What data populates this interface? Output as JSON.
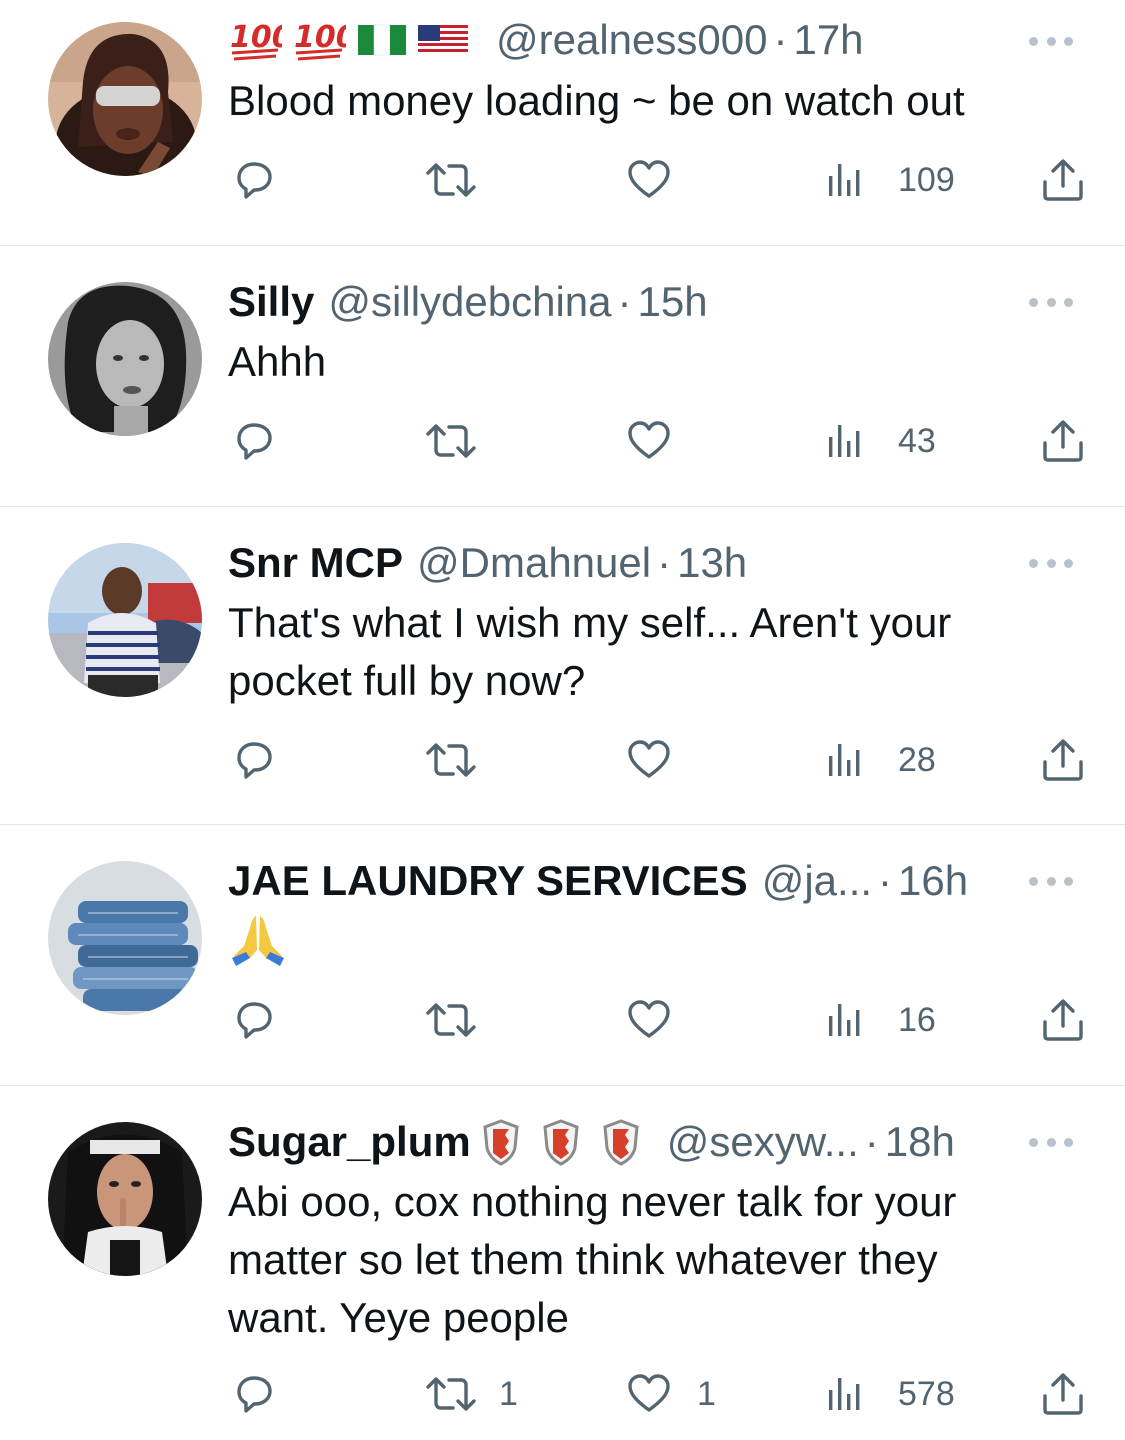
{
  "tweets": [
    {
      "name": "",
      "name_emojis": "💯 💯",
      "handle": "@realness000",
      "sep": "·",
      "time": "17h",
      "body": "Blood money loading ~ be on watch out",
      "replies": "",
      "retweets": "",
      "likes": "",
      "views": "109"
    },
    {
      "name": "Silly",
      "handle": "@sillydebchina",
      "sep": "·",
      "time": "15h",
      "body": "Ahhh",
      "replies": "",
      "retweets": "",
      "likes": "",
      "views": "43"
    },
    {
      "name": "Snr MCP",
      "handle": "@Dmahnuel",
      "sep": "·",
      "time": "13h",
      "body_lines": [
        "That's what I wish my self... Aren't your",
        "pocket full by now?"
      ],
      "replies": "",
      "retweets": "",
      "likes": "",
      "views": "28"
    },
    {
      "name": "JAE LAUNDRY SERVICES",
      "handle": "@ja...",
      "sep": "·",
      "time": "16h",
      "body": "🙏",
      "replies": "",
      "retweets": "",
      "likes": "",
      "views": "16"
    },
    {
      "name": "Sugar_plum",
      "handle": "@sexyw...",
      "sep": "·",
      "time": "18h",
      "body_lines": [
        "Abi ooo, cox nothing never talk for your",
        "matter so let them think whatever they",
        "want. Yeye people"
      ],
      "replies": "",
      "retweets": "1",
      "likes": "1",
      "views": "578"
    }
  ],
  "colors": {
    "text": "#0f1419",
    "secondary": "#536471",
    "divider": "#e1e5e9",
    "emoji_red": "#d62b2b",
    "nigeria_green": "#1a8a3a"
  },
  "icons": [
    "reply-icon",
    "retweet-icon",
    "like-icon",
    "views-icon",
    "share-icon",
    "more-icon"
  ]
}
